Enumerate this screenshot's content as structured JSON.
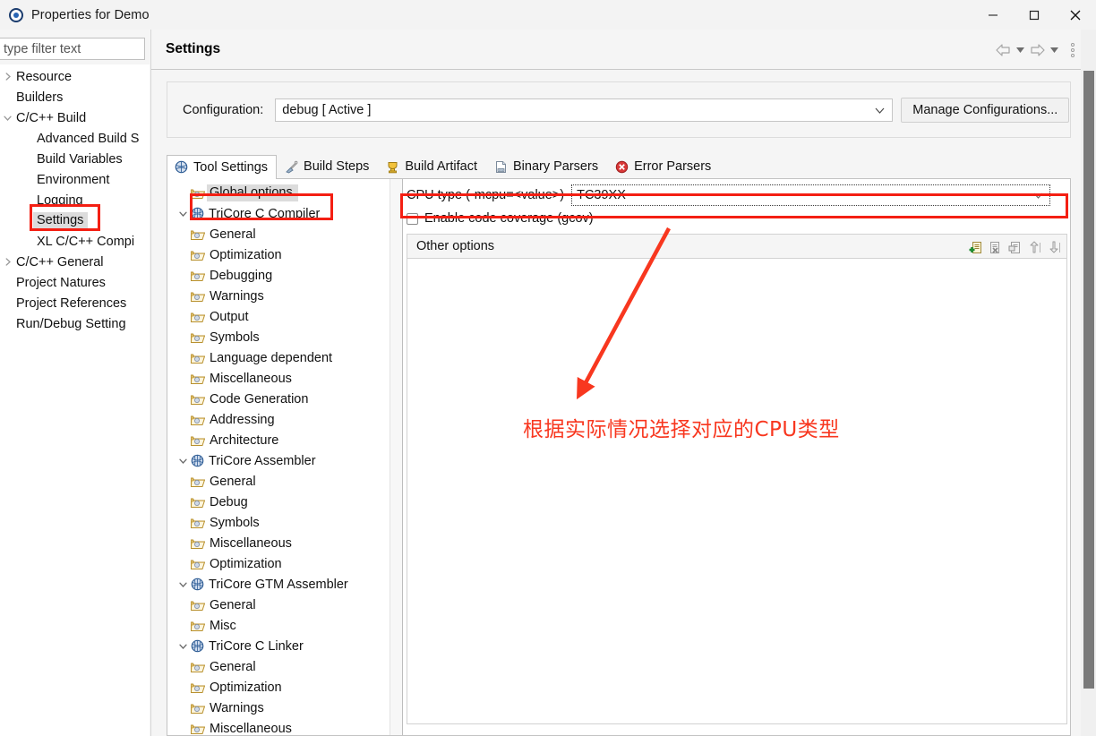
{
  "window": {
    "title": "Properties for Demo",
    "icon": "eclipse-properties-icon",
    "controls": {
      "minimize": "minimize-icon",
      "maximize": "maximize-icon",
      "close": "close-icon"
    }
  },
  "filter": {
    "placeholder": "type filter text",
    "value": ""
  },
  "nav_tree": [
    {
      "label": "Resource",
      "indent": 0,
      "twisty": "collapsed",
      "selected": false
    },
    {
      "label": "Builders",
      "indent": 1,
      "twisty": "none",
      "selected": false
    },
    {
      "label": "C/C++ Build",
      "indent": 0,
      "twisty": "expanded",
      "selected": false
    },
    {
      "label": "Advanced Build S",
      "indent": 2,
      "twisty": "none",
      "selected": false
    },
    {
      "label": "Build Variables",
      "indent": 2,
      "twisty": "none",
      "selected": false
    },
    {
      "label": "Environment",
      "indent": 2,
      "twisty": "none",
      "selected": false
    },
    {
      "label": "Logging",
      "indent": 2,
      "twisty": "none",
      "selected": false
    },
    {
      "label": "Settings",
      "indent": 2,
      "twisty": "none",
      "selected": true
    },
    {
      "label": "XL C/C++ Compi",
      "indent": 2,
      "twisty": "none",
      "selected": false
    },
    {
      "label": "C/C++ General",
      "indent": 0,
      "twisty": "collapsed",
      "selected": false
    },
    {
      "label": "Project Natures",
      "indent": 1,
      "twisty": "none",
      "selected": false
    },
    {
      "label": "Project References",
      "indent": 1,
      "twisty": "none",
      "selected": false
    },
    {
      "label": "Run/Debug Setting",
      "indent": 1,
      "twisty": "none",
      "selected": false
    }
  ],
  "page": {
    "title": "Settings",
    "nav_back": "back-arrow-icon",
    "nav_forward": "forward-arrow-icon",
    "menu": "view-menu-icon"
  },
  "configuration": {
    "label": "Configuration:",
    "value": "debug  [ Active ]",
    "manage_button": "Manage Configurations..."
  },
  "tabs": [
    {
      "label": "Tool Settings",
      "icon": "tool-settings-icon",
      "active": true
    },
    {
      "label": "Build Steps",
      "icon": "build-steps-icon",
      "active": false
    },
    {
      "label": "Build Artifact",
      "icon": "build-artifact-icon",
      "active": false
    },
    {
      "label": "Binary Parsers",
      "icon": "binary-parsers-icon",
      "active": false
    },
    {
      "label": "Error Parsers",
      "icon": "error-parsers-icon",
      "active": false
    }
  ],
  "options_tree": [
    {
      "label": "Global options",
      "level": 1,
      "icon": "folder-icon",
      "twisty": "none",
      "selected": true
    },
    {
      "label": "TriCore C Compiler",
      "level": 0,
      "icon": "tool-icon",
      "twisty": "expanded",
      "selected": false
    },
    {
      "label": "General",
      "level": 1,
      "icon": "folder-icon",
      "twisty": "none",
      "selected": false
    },
    {
      "label": "Optimization",
      "level": 1,
      "icon": "folder-icon",
      "twisty": "none",
      "selected": false
    },
    {
      "label": "Debugging",
      "level": 1,
      "icon": "folder-icon",
      "twisty": "none",
      "selected": false
    },
    {
      "label": "Warnings",
      "level": 1,
      "icon": "folder-icon",
      "twisty": "none",
      "selected": false
    },
    {
      "label": "Output",
      "level": 1,
      "icon": "folder-icon",
      "twisty": "none",
      "selected": false
    },
    {
      "label": "Symbols",
      "level": 1,
      "icon": "folder-icon",
      "twisty": "none",
      "selected": false
    },
    {
      "label": "Language dependent",
      "level": 1,
      "icon": "folder-icon",
      "twisty": "none",
      "selected": false
    },
    {
      "label": "Miscellaneous",
      "level": 1,
      "icon": "folder-icon",
      "twisty": "none",
      "selected": false
    },
    {
      "label": "Code Generation",
      "level": 1,
      "icon": "folder-icon",
      "twisty": "none",
      "selected": false
    },
    {
      "label": "Addressing",
      "level": 1,
      "icon": "folder-icon",
      "twisty": "none",
      "selected": false
    },
    {
      "label": "Architecture",
      "level": 1,
      "icon": "folder-icon",
      "twisty": "none",
      "selected": false
    },
    {
      "label": "TriCore Assembler",
      "level": 0,
      "icon": "tool-icon",
      "twisty": "expanded",
      "selected": false
    },
    {
      "label": "General",
      "level": 1,
      "icon": "folder-icon",
      "twisty": "none",
      "selected": false
    },
    {
      "label": "Debug",
      "level": 1,
      "icon": "folder-icon",
      "twisty": "none",
      "selected": false
    },
    {
      "label": "Symbols",
      "level": 1,
      "icon": "folder-icon",
      "twisty": "none",
      "selected": false
    },
    {
      "label": "Miscellaneous",
      "level": 1,
      "icon": "folder-icon",
      "twisty": "none",
      "selected": false
    },
    {
      "label": "Optimization",
      "level": 1,
      "icon": "folder-icon",
      "twisty": "none",
      "selected": false
    },
    {
      "label": "TriCore GTM Assembler",
      "level": 0,
      "icon": "tool-icon",
      "twisty": "expanded",
      "selected": false
    },
    {
      "label": "General",
      "level": 1,
      "icon": "folder-icon",
      "twisty": "none",
      "selected": false
    },
    {
      "label": "Misc",
      "level": 1,
      "icon": "folder-icon",
      "twisty": "none",
      "selected": false
    },
    {
      "label": "TriCore C Linker",
      "level": 0,
      "icon": "tool-icon",
      "twisty": "expanded",
      "selected": false
    },
    {
      "label": "General",
      "level": 1,
      "icon": "folder-icon",
      "twisty": "none",
      "selected": false
    },
    {
      "label": "Optimization",
      "level": 1,
      "icon": "folder-icon",
      "twisty": "none",
      "selected": false
    },
    {
      "label": "Warnings",
      "level": 1,
      "icon": "folder-icon",
      "twisty": "none",
      "selected": false
    },
    {
      "label": "Miscellaneous",
      "level": 1,
      "icon": "folder-icon",
      "twisty": "none",
      "selected": false
    }
  ],
  "tool_options": {
    "cpu_type_label": "CPU type (-mcpu=<value>)",
    "cpu_type_value": "TC39XX",
    "code_coverage_label": "Enable code coverage (gcov)",
    "code_coverage_checked": false,
    "other_options_label": "Other options",
    "other_options_toolbar": [
      "add-option-icon",
      "delete-option-icon",
      "edit-option-icon",
      "move-up-icon",
      "move-down-icon"
    ],
    "other_options_values": []
  },
  "annotations": {
    "text": "根据实际情况选择对应的CPU类型",
    "color": "#f8371f",
    "boxes": [
      "settings-nav-highlight",
      "global-options-highlight",
      "cpu-type-highlight"
    ],
    "arrow": "red-arrow-pointing-to-cpu-type"
  }
}
